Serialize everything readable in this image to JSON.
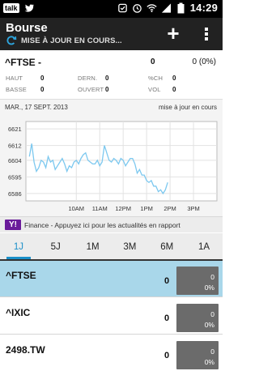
{
  "status": {
    "talk": "talk",
    "time": "14:29"
  },
  "header": {
    "title": "Bourse",
    "subtitle": "MISE À JOUR EN COURS..."
  },
  "detail": {
    "symbol": "^FTSE -",
    "value": "0",
    "change": "0 (0%)",
    "stats": [
      {
        "label": "HAUT",
        "value": "0"
      },
      {
        "label": "DERN.",
        "value": "0"
      },
      {
        "label": "%CH",
        "value": "0"
      },
      {
        "label": "BASSE",
        "value": "0"
      },
      {
        "label": "OUVERT",
        "value": "0"
      },
      {
        "label": "VOL",
        "value": "0"
      }
    ]
  },
  "chart_data": {
    "type": "line",
    "date_label": "MAR., 17 SEPT. 2013",
    "update_label": "mise à jour en cours",
    "y_ticks": [
      "6621",
      "6612",
      "6604",
      "6595",
      "6586"
    ],
    "x_ticks": [
      "10AM",
      "11AM",
      "12PM",
      "1PM",
      "2PM",
      "3PM"
    ],
    "ylim": [
      6582,
      6625
    ],
    "x": [
      8.0,
      8.1,
      8.2,
      8.3,
      8.4,
      8.5,
      8.6,
      8.7,
      8.8,
      8.9,
      9.0,
      9.1,
      9.2,
      9.3,
      9.4,
      9.5,
      9.6,
      9.7,
      9.8,
      9.9,
      10.0,
      10.1,
      10.2,
      10.3,
      10.4,
      10.5,
      10.6,
      10.7,
      10.8,
      10.9,
      11.0,
      11.1,
      11.2,
      11.3,
      11.4,
      11.5,
      11.6,
      11.7,
      11.8,
      11.9,
      12.0,
      12.1,
      12.2,
      12.3,
      12.4,
      12.5,
      12.6,
      12.7,
      12.8,
      12.9,
      13.0,
      13.1,
      13.2,
      13.3,
      13.4,
      13.5,
      13.6,
      13.7,
      13.8,
      13.9
    ],
    "series": [
      {
        "color": "#7cc8ef",
        "values": [
          6606,
          6613,
          6603,
          6598,
          6600,
          6604,
          6603,
          6600,
          6606,
          6603,
          6604,
          6599,
          6601,
          6603,
          6605,
          6602,
          6598,
          6601,
          6600,
          6603,
          6604,
          6602,
          6605,
          6607,
          6608,
          6604,
          6603,
          6602,
          6602,
          6604,
          6601,
          6603,
          6612,
          6608,
          6604,
          6603,
          6605,
          6604,
          6602,
          6605,
          6604,
          6601,
          6603,
          6605,
          6605,
          6602,
          6597,
          6599,
          6596,
          6596,
          6593,
          6592,
          6593,
          6590,
          6590,
          6587,
          6588,
          6586,
          6588,
          6592
        ]
      }
    ],
    "xlim": [
      7.85,
      16.0
    ]
  },
  "finance": {
    "logo": "Y!",
    "text": "Finance - Appuyez ici pour les actualités en rapport"
  },
  "tabs": [
    {
      "label": "1J",
      "selected": true
    },
    {
      "label": "5J"
    },
    {
      "label": "1M"
    },
    {
      "label": "3M"
    },
    {
      "label": "6M"
    },
    {
      "label": "1A"
    }
  ],
  "stocks": [
    {
      "symbol": "^FTSE",
      "value": "0",
      "change": "0",
      "percent": "0%",
      "selected": true
    },
    {
      "symbol": "^IXIC",
      "value": "0",
      "change": "0",
      "percent": "0%"
    },
    {
      "symbol": "2498.TW",
      "value": "0",
      "change": "0",
      "percent": "0%"
    }
  ],
  "icons": [
    "twitter-icon",
    "notification-icon",
    "alarm-icon",
    "wifi-icon",
    "signal-icon",
    "battery-icon",
    "refresh-icon",
    "plus-icon",
    "overflow-menu-icon",
    "yahoo-logo"
  ]
}
